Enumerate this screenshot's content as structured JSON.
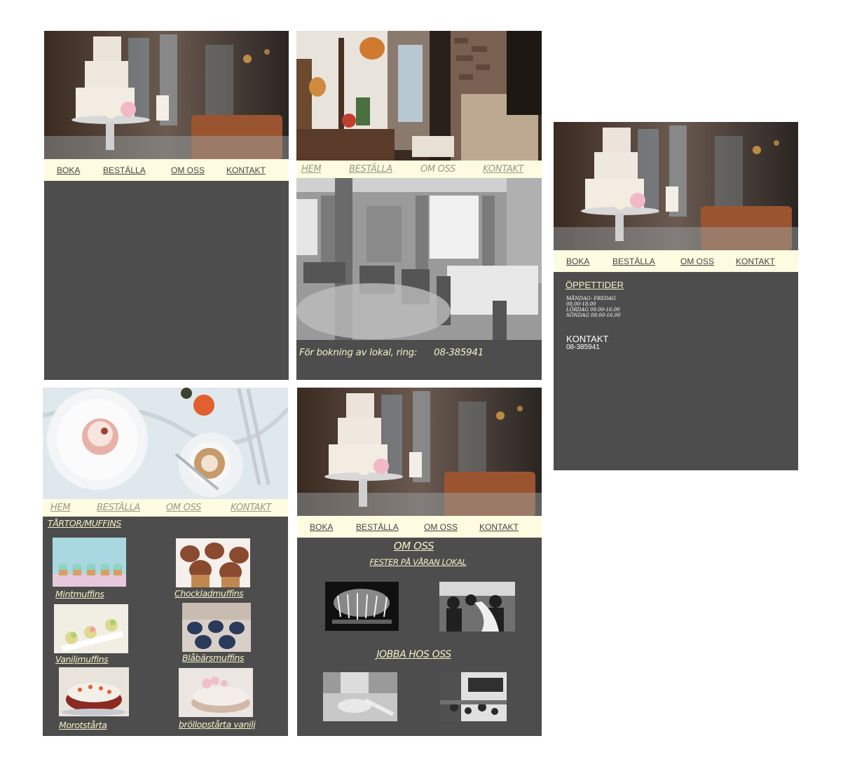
{
  "nav_primary": {
    "boka": "BOKA",
    "bestalla": "BESTÄLLA",
    "om_oss": "OM OSS",
    "kontakt": "KONTAKT"
  },
  "nav_secondary": {
    "hem": "HEM",
    "bestalla": "BESTÄLLA",
    "om_oss": "OM OSS",
    "kontakt": "KONTAKT"
  },
  "booking": {
    "text": "För bokning av lokal, ring:",
    "phone": "08-385941"
  },
  "hours": {
    "title": "ÖPPETTIDER",
    "lines": [
      "MÅNDAG- FREDAG",
      "08.00-18.00",
      "LÖRDAG 09.00-16.00",
      "SÖNDAG 09.00-16.00"
    ]
  },
  "contact": {
    "title": "KONTAKT",
    "phone": "08-385941"
  },
  "shop": {
    "heading": "TÅRTOR/MUFFINS",
    "products": [
      "Mintmuffins",
      "Chockladmuffins",
      "Vaniljmuffins",
      "Blåbärsmuffins",
      "Morotstårta",
      "bröllopstårta vanilj"
    ]
  },
  "about": {
    "title": "OM OSS",
    "subtitle": "FESTER PÅ VÅRAN LOKAL",
    "jobs_title": "JOBBA HOS OSS"
  },
  "colors": {
    "panel": "#4d4d4d",
    "nav_bg": "#fdfce0",
    "accent_text": "#f6f0c6"
  },
  "icons": [
    "cake-photo",
    "cafe-interior-photo",
    "dining-room-photo",
    "coffee-cupcake-photo"
  ]
}
